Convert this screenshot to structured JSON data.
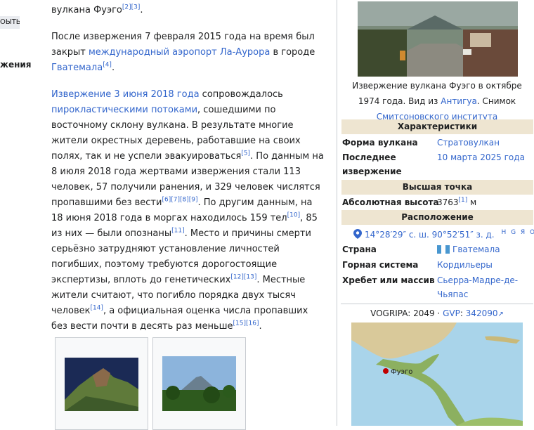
{
  "sidebar": {
    "button_fragment": "ОЫТЬ",
    "text_fragment": "жения"
  },
  "article": {
    "p0": {
      "text": "вулкана Фуэго",
      "refs": "[2][3]",
      "end": "."
    },
    "p1": {
      "t1": "После извержения 7 февраля 2015 года на время был закрыт ",
      "link1": "международный аэропорт Ла-Аурора",
      "t2": " в городе ",
      "link2": "Гватемала",
      "ref1": "[4]",
      "end": "."
    },
    "p2": {
      "link1": "Извержение 3 июня 2018 года",
      "t1": " сопровождалось ",
      "link2": "пирокластическими потоками",
      "t2": ", сошедшими по восточному склону вулкана. В результате многие жители окрестных деревень, работавшие на своих полях, так и не успели эвакуироваться",
      "ref1": "[5]",
      "t3": ". По данным на 8 июля 2018 года жертвами извержения стали 113 человек, 57 получили ранения, и 329 человек числятся пропавшими без вести",
      "ref2": "[6][7][8][9]",
      "t4": ". По другим данным, на 18 июня 2018 года в моргах находилось 159 тел",
      "ref3": "[10]",
      "t5": ", 85 из них — были опознаны",
      "ref4": "[11]",
      "t6": ". Место и причины смерти серьёзно затрудняют установление личностей погибших, поэтому требуются дорогостоящие экспертизы, вплоть до генетических",
      "ref5": "[12][13]",
      "t7": ". Местные жители считают, что погибло порядка двух тысяч человек",
      "ref6": "[14]",
      "t8": ", а официальная оценка числа пропавших без вести почти в десять раз меньше",
      "ref7": "[15][16]",
      "end": "."
    }
  },
  "infobox": {
    "caption": {
      "t1": "Извержение вулкана Фуэго в октябре 1974 года. Вид из ",
      "link1": "Антигуа",
      "t2": ". Снимок ",
      "link2": "Смитсоновского института"
    },
    "section_characteristics": "Характеристики",
    "form_label": "Форма вулкана",
    "form_value": "Стратовулкан",
    "last_label": "Последнее извержение",
    "last_value": "10 марта 2025 года",
    "section_peak": "Высшая точка",
    "height_label": "Абсолютная высота",
    "height_value": "3763",
    "height_ref": "[1]",
    "height_unit": " м",
    "section_location": "Расположение",
    "coords": "14°28′29″ с. ш. 90°52′51″ з. д.",
    "coords_links": "H G Я O",
    "country_label": "Страна",
    "country_value": "Гватемала",
    "system_label": "Горная система",
    "system_value": "Кордильеры",
    "ridge_label": "Хребет или массив",
    "ridge_value": "Сьерра-Мадре-де-Чьяпас",
    "vogripa_label": "VOGRIPA",
    "vogripa_value": "2049",
    "gvp_label": "GVP",
    "gvp_value": "342090",
    "map_label": "Фуэго"
  },
  "colors": {
    "link": "#3366cc",
    "infobox_header": "#eee5d1",
    "border": "#c8ccd1"
  }
}
